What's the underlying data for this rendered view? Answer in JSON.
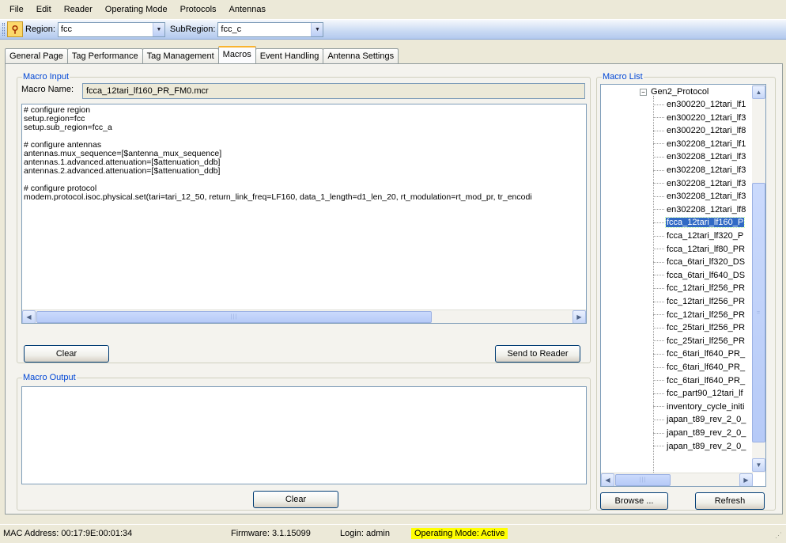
{
  "menu": [
    "File",
    "Edit",
    "Reader",
    "Operating Mode",
    "Protocols",
    "Antennas"
  ],
  "toolbar": {
    "region_label": "Region:",
    "region_value": "fcc",
    "subregion_label": "SubRegion:",
    "subregion_value": "fcc_c"
  },
  "tabs": [
    "General Page",
    "Tag Performance",
    "Tag Management",
    "Macros",
    "Event Handling",
    "Antenna Settings"
  ],
  "active_tab": "Macros",
  "macro_input": {
    "title": "Macro Input",
    "name_label": "Macro Name:",
    "name_value": "fcca_12tari_lf160_PR_FM0.mcr",
    "lines": [
      "# configure region",
      "setup.region=fcc",
      "setup.sub_region=fcc_a",
      "",
      "# configure antennas",
      "antennas.mux_sequence=[$antenna_mux_sequence]",
      "antennas.1.advanced.attenuation=[$attenuation_ddb]",
      "antennas.2.advanced.attenuation=[$attenuation_ddb]",
      "",
      "# configure protocol",
      "modem.protocol.isoc.physical.set(tari=tari_12_50, return_link_freq=LF160, data_1_length=d1_len_20, rt_modulation=rt_mod_pr, tr_encodi"
    ],
    "clear_label": "Clear",
    "send_label": "Send to Reader"
  },
  "macro_output": {
    "title": "Macro Output",
    "clear_label": "Clear"
  },
  "macro_list": {
    "title": "Macro List",
    "root": "Gen2_Protocol",
    "items": [
      "en300220_12tari_lf1",
      "en300220_12tari_lf3",
      "en300220_12tari_lf8",
      "en302208_12tari_lf1",
      "en302208_12tari_lf3",
      "en302208_12tari_lf3",
      "en302208_12tari_lf3",
      "en302208_12tari_lf3",
      "en302208_12tari_lf8",
      "fcca_12tari_lf160_P",
      "fcca_12tari_lf320_P",
      "fcca_12tari_lf80_PR",
      "fcca_6tari_lf320_DS",
      "fcca_6tari_lf640_DS",
      "fcc_12tari_lf256_PR",
      "fcc_12tari_lf256_PR",
      "fcc_12tari_lf256_PR",
      "fcc_25tari_lf256_PR",
      "fcc_25tari_lf256_PR",
      "fcc_6tari_lf640_PR_",
      "fcc_6tari_lf640_PR_",
      "fcc_6tari_lf640_PR_",
      "fcc_part90_12tari_lf",
      "inventory_cycle_initi",
      "japan_t89_rev_2_0_",
      "japan_t89_rev_2_0_",
      "japan_t89_rev_2_0_"
    ],
    "selected_index": 9,
    "browse_label": "Browse ...",
    "refresh_label": "Refresh"
  },
  "status": {
    "mac": "MAC Address: 00:17:9E:00:01:34",
    "firmware": "Firmware: 3.1.15099",
    "login": "Login: admin",
    "opmode": "Operating Mode: Active"
  },
  "colors": {
    "group_title": "#0046d5",
    "selection": "#316ac5",
    "opmode_highlight": "#ffff00"
  }
}
